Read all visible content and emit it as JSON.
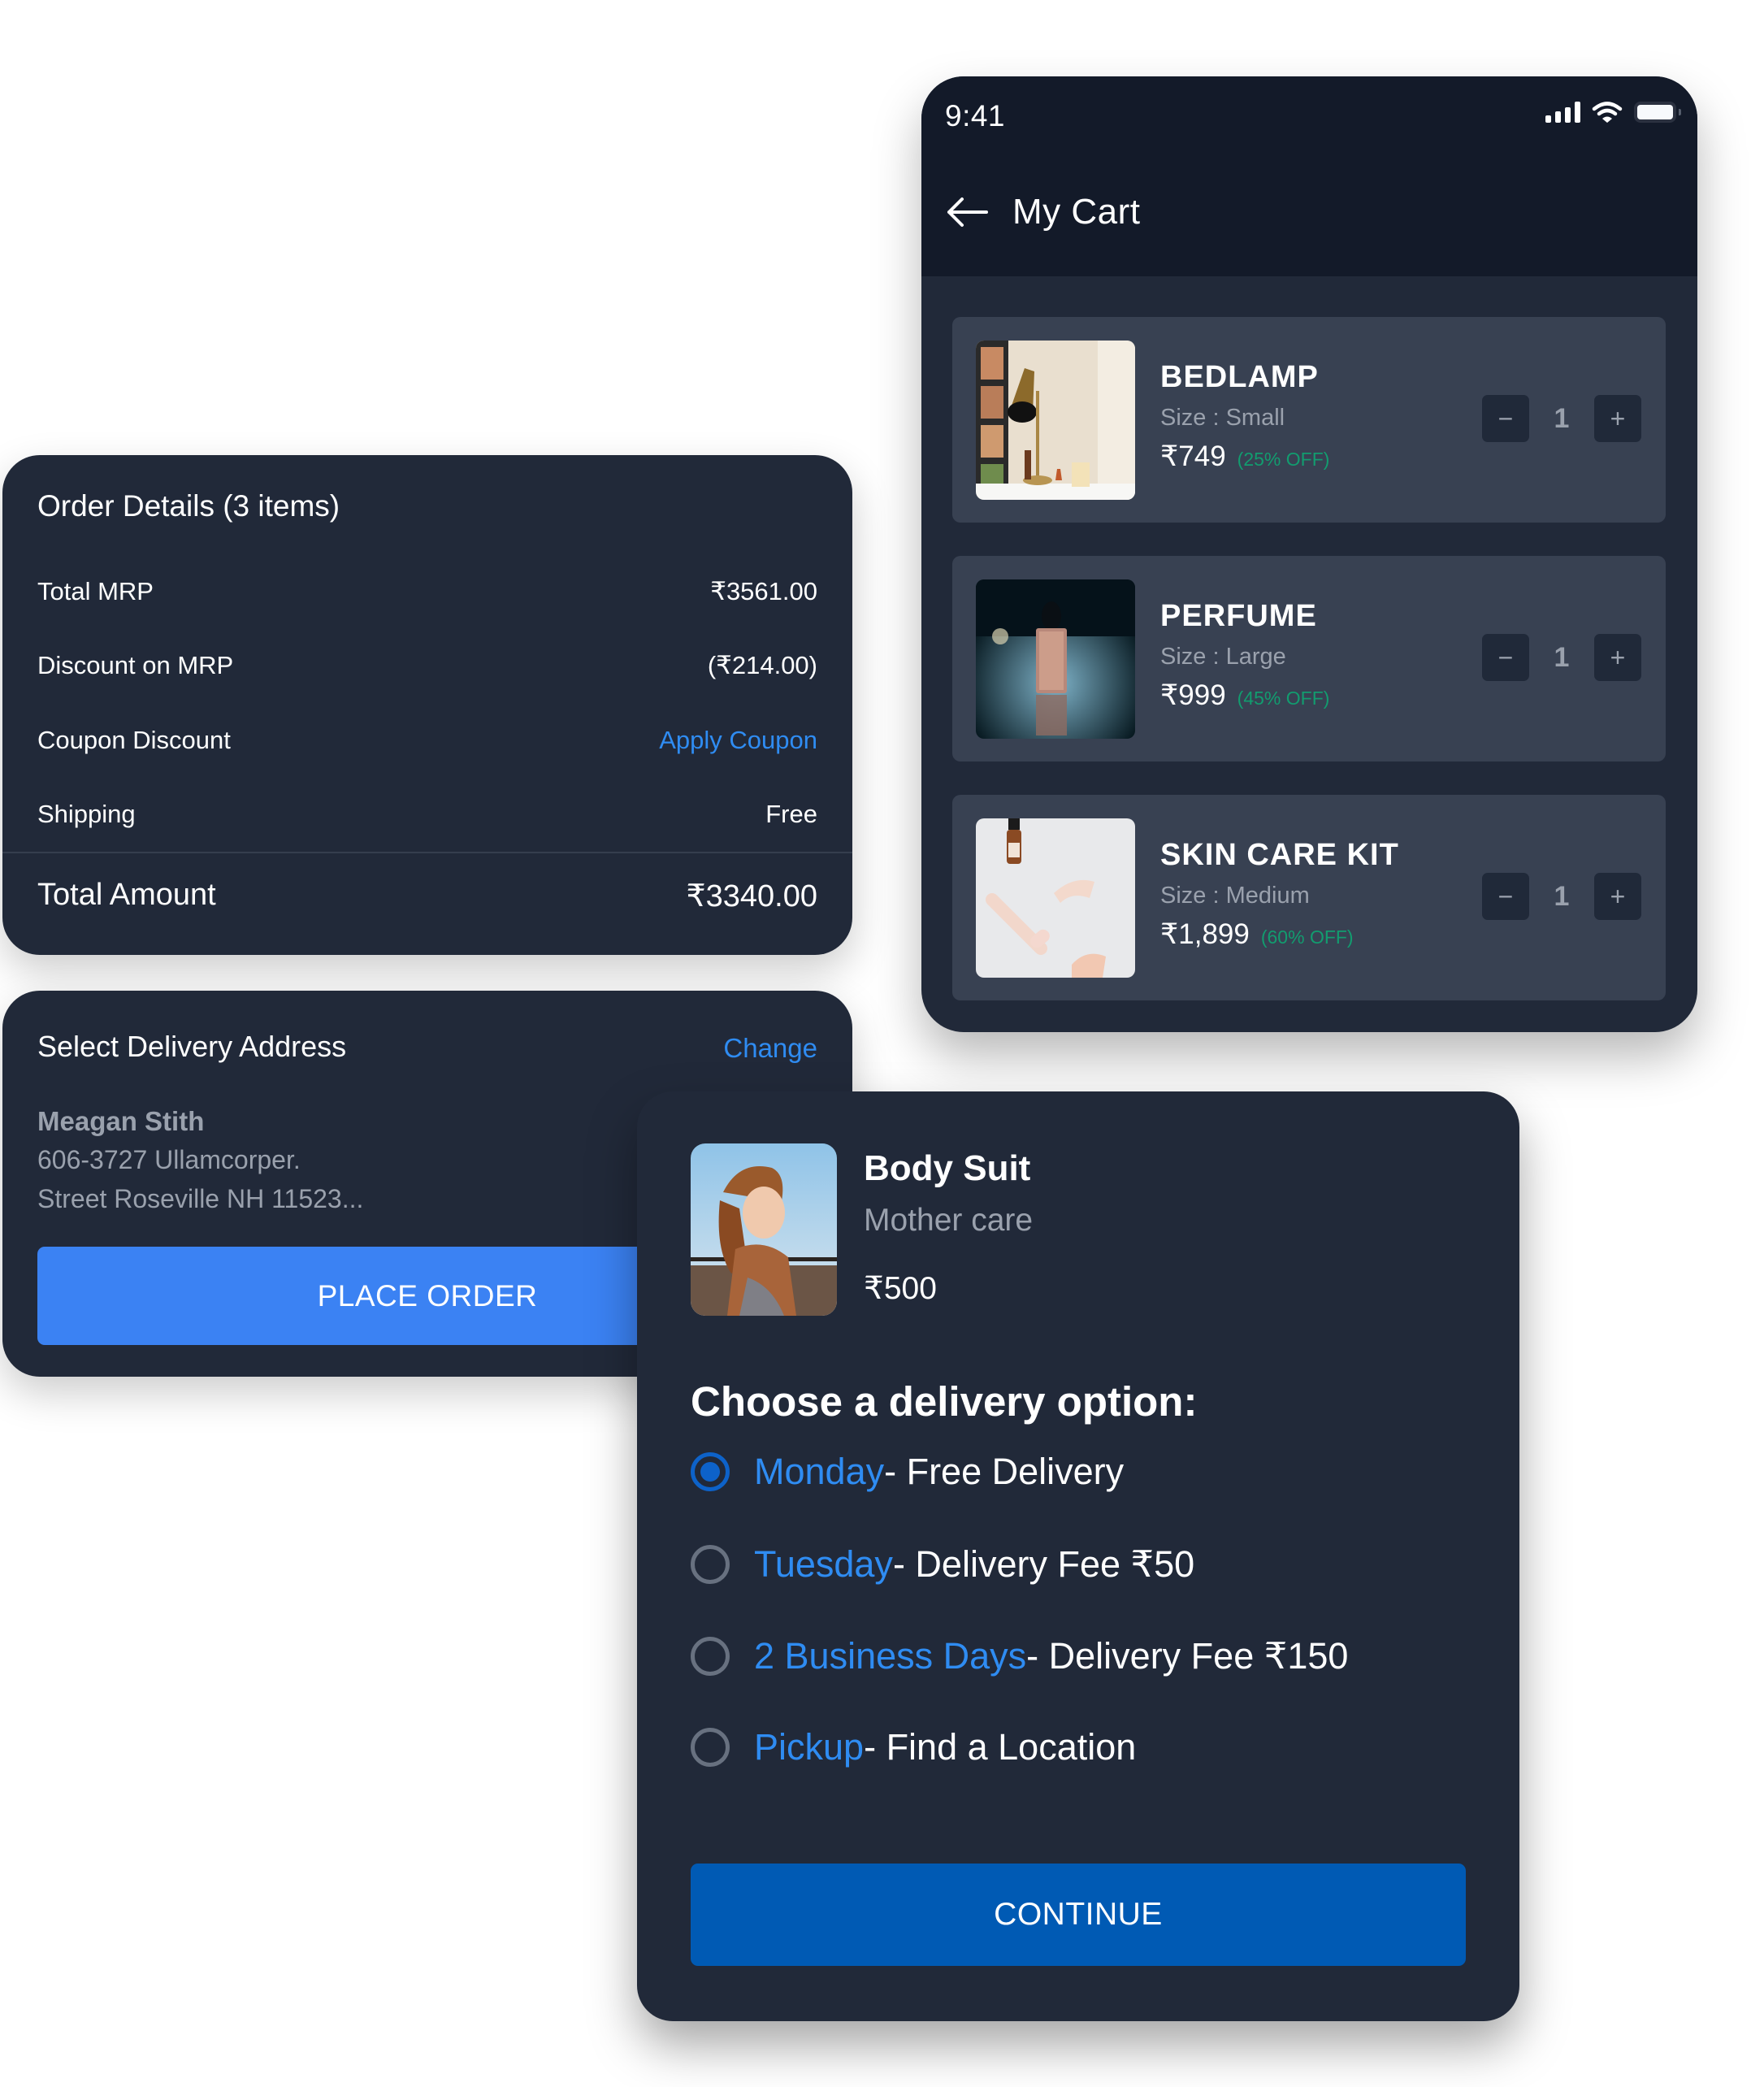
{
  "status_bar": {
    "time": "9:41"
  },
  "cart": {
    "title": "My Cart",
    "items": [
      {
        "name": "BEDLAMP",
        "size": "Size : Small",
        "price": "₹749",
        "discount": "(25% OFF)",
        "quantity": "1",
        "image": "bedlamp-photo"
      },
      {
        "name": "PERFUME",
        "size": "Size : Large",
        "price": "₹999",
        "discount": "(45% OFF)",
        "quantity": "1",
        "image": "perfume-photo"
      },
      {
        "name": "SKIN CARE KIT",
        "size": "Size : Medium",
        "price": "₹1,899",
        "discount": "(60% OFF)",
        "quantity": "1",
        "image": "skin-care-photo"
      }
    ],
    "decrement_label": "−",
    "increment_label": "+"
  },
  "order_details": {
    "title": "Order Details (3 items)",
    "rows": [
      {
        "label": "Total MRP",
        "value": "₹3561.00"
      },
      {
        "label": "Discount on MRP",
        "value": "(₹214.00)"
      },
      {
        "label": "Coupon Discount",
        "value": "Apply Coupon"
      },
      {
        "label": "Shipping",
        "value": "Free"
      }
    ],
    "total_label": "Total Amount",
    "total_value": "₹3340.00"
  },
  "address": {
    "title": "Select Delivery Address",
    "change_label": "Change",
    "name": "Meagan Stith",
    "line1": "606-3727 Ullamcorper.",
    "line2": "Street Roseville NH 11523...",
    "place_order_label": "PLACE ORDER"
  },
  "delivery": {
    "product_name": "Body Suit",
    "product_brand": "Mother care",
    "product_price": "₹500",
    "heading": "Choose a delivery option:",
    "options": [
      {
        "highlight": "Monday",
        "text": "- Free Delivery",
        "selected": true
      },
      {
        "highlight": "Tuesday",
        "text": "- Delivery Fee ₹50",
        "selected": false
      },
      {
        "highlight": "2 Business Days",
        "text": "- Delivery Fee ₹150",
        "selected": false
      },
      {
        "highlight": "Pickup",
        "text": "- Find a Location",
        "selected": false
      }
    ],
    "continue_label": "CONTINUE"
  },
  "colors": {
    "card_bg": "#212939",
    "header_bg": "#131a29",
    "item_bg": "#384152",
    "link_blue": "#2f8cf2",
    "place_order_blue": "#3b82f3",
    "continue_blue": "#005ab4",
    "discount_green": "#129c6f"
  }
}
